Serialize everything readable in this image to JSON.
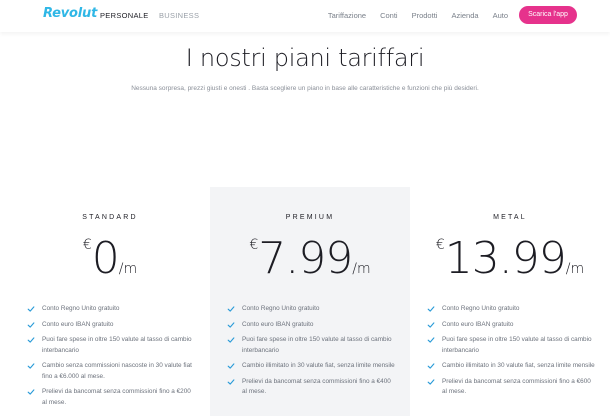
{
  "header": {
    "logo": "Revolut",
    "nav_left": [
      "PERSONALE",
      "BUSINESS"
    ],
    "nav_right": [
      "Tariffazione",
      "Conti",
      "Prodotti",
      "Azienda",
      "Auto"
    ],
    "cta": "Scarica l'app"
  },
  "title": "I nostri piani tariffari",
  "subtitle": "Nessuna sorpresa, prezzi giusti e onesti . Basta scegliere un piano in base alle caratteristiche e funzioni che più desideri.",
  "colors": {
    "accent": "#e6328c",
    "brand": "#2fb7e6",
    "check": "#2a9bd8",
    "highlight_bg": "#f3f4f6"
  },
  "plans": [
    {
      "name": "STANDARD",
      "currency": "€",
      "amount": "0",
      "per": "/m",
      "features": [
        "Conto Regno Unito gratuito",
        "Conto euro IBAN gratuito",
        "Puoi fare spese in oltre 150 valute al tasso di cambio interbancario",
        "Cambio senza commissioni nascoste in 30 valute fiat fino a €6.000 al mese.",
        "Prelievi da bancomat senza commissioni fino a €200 al mese."
      ]
    },
    {
      "name": "PREMIUM",
      "currency": "€",
      "amount": "7.99",
      "per": "/m",
      "features": [
        "Conto Regno Unito gratuito",
        "Conto euro IBAN gratuito",
        "Puoi fare spese in oltre 150 valute al tasso di cambio interbancario",
        "Cambio illimitato in 30 valute fiat, senza limite mensile",
        "Prelievi da bancomat senza commissioni fino a €400 al mese."
      ]
    },
    {
      "name": "METAL",
      "currency": "€",
      "amount": "13.99",
      "per": "/m",
      "features": [
        "Conto Regno Unito gratuito",
        "Conto euro IBAN gratuito",
        "Puoi fare spese in oltre 150 valute al tasso di cambio interbancario",
        "Cambio illimitato in 30 valute fiat, senza limite mensile",
        "Prelievi da bancomat senza commissioni fino a €600 al mese."
      ]
    }
  ]
}
